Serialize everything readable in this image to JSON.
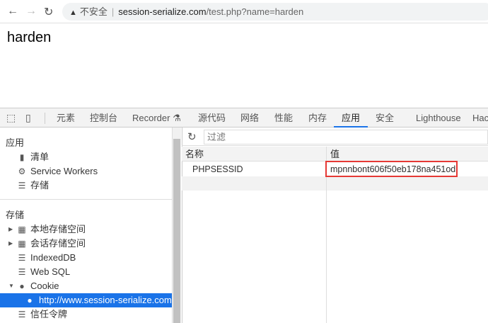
{
  "browser": {
    "security_label": "不安全",
    "url_host": "session-serialize.com",
    "url_path": "/test.php?name=harden"
  },
  "page": {
    "text": "harden"
  },
  "devtools": {
    "tabs": [
      "元素",
      "控制台",
      "Recorder ⚗",
      "源代码",
      "网络",
      "性能",
      "内存",
      "应用",
      "安全",
      "Lighthouse",
      "Hac"
    ],
    "active_tab": "应用",
    "sidebar": {
      "app_section": "应用",
      "app_items": [
        "清单",
        "Service Workers",
        "存储"
      ],
      "storage_section": "存储",
      "storage_items": [
        "本地存储空间",
        "会话存储空间",
        "IndexedDB",
        "Web SQL",
        "Cookie",
        "http://www.session-serialize.com",
        "信任令牌"
      ]
    },
    "filter_placeholder": "过滤",
    "table": {
      "headers": [
        "名称",
        "值"
      ],
      "rows": [
        {
          "name": "PHPSESSID",
          "value": "mpnnbont606f50eb178na451od"
        }
      ]
    }
  },
  "colors": {
    "accent": "#1a73e8",
    "highlight": "#e53935"
  }
}
